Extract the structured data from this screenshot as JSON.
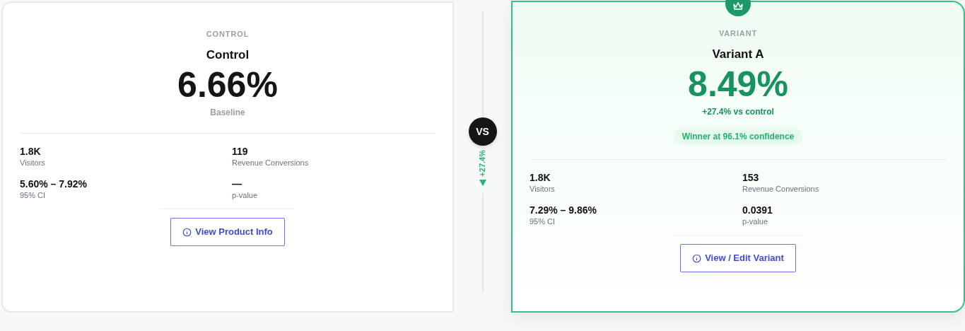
{
  "cards": [
    {
      "kind": "control",
      "winner": false,
      "eyebrow": "CONTROL",
      "name": "Control",
      "rate": "6.66%",
      "subtitle": "Baseline",
      "stats": [
        {
          "value": "1.8K",
          "label": "Visitors"
        },
        {
          "value": "119",
          "label": "Revenue Conversions"
        },
        {
          "value": "5.60% – 7.92%",
          "label": "95% CI"
        },
        {
          "value": "—",
          "label": "p-value"
        }
      ],
      "button": "View Product Info"
    },
    {
      "kind": "variant",
      "winner": true,
      "eyebrow": "VARIANT",
      "name": "Variant A",
      "rate": "8.49%",
      "subtitle": "+27.4% vs control",
      "badge": "Winner at 96.1% confidence",
      "stats": [
        {
          "value": "1.8K",
          "label": "Visitors"
        },
        {
          "value": "153",
          "label": "Revenue Conversions"
        },
        {
          "value": "7.29% – 9.86%",
          "label": "95% CI"
        },
        {
          "value": "0.0391",
          "label": "p-value"
        }
      ],
      "button": "View / Edit Variant"
    }
  ],
  "comparison": {
    "vs_label": "VS",
    "lift": "+27.4%"
  }
}
